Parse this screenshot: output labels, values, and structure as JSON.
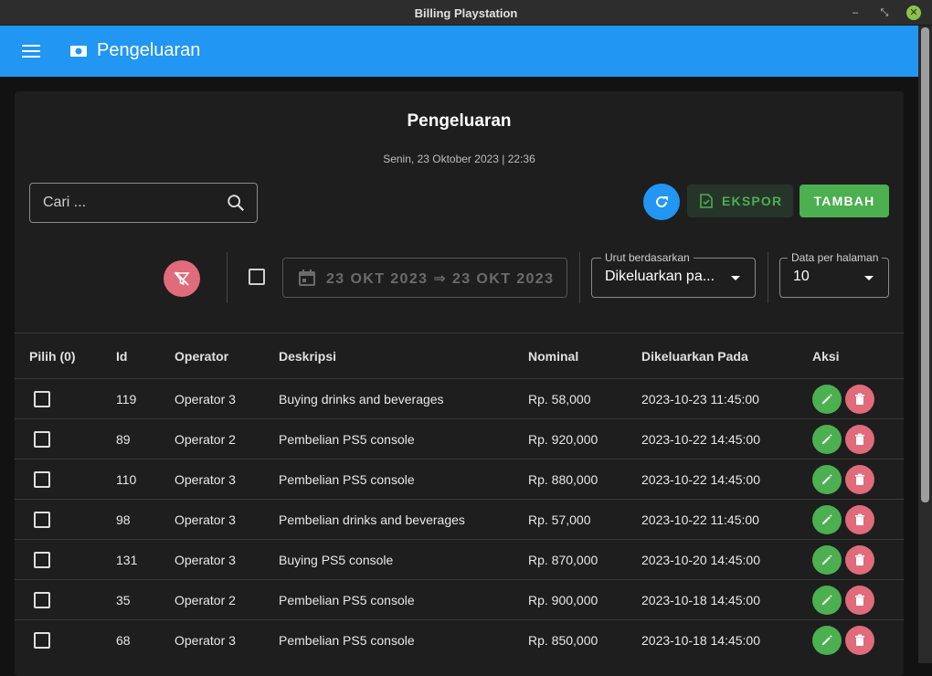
{
  "window": {
    "title": "Billing Playstation"
  },
  "appbar": {
    "title": "Pengeluaran"
  },
  "page": {
    "title": "Pengeluaran",
    "date": "Senin, 23 Oktober 2023 | 22:36"
  },
  "search": {
    "placeholder": "Cari ..."
  },
  "toolbar": {
    "export_label": "EKSPOR",
    "add_label": "TAMBAH"
  },
  "filters": {
    "date_range": "23 OKT 2023 ⇒ 23 OKT 2023",
    "sort": {
      "label": "Urut berdasarkan",
      "value": "Dikeluarkan pa..."
    },
    "per_page": {
      "label": "Data per halaman",
      "value": "10"
    }
  },
  "table": {
    "headers": [
      "Pilih (0)",
      "Id",
      "Operator",
      "Deskripsi",
      "Nominal",
      "Dikeluarkan Pada",
      "Aksi"
    ],
    "rows": [
      {
        "id": "119",
        "operator": "Operator 3",
        "desc": "Buying drinks and beverages",
        "nominal": "Rp. 58,000",
        "date": "2023-10-23 11:45:00"
      },
      {
        "id": "89",
        "operator": "Operator 2",
        "desc": "Pembelian PS5 console",
        "nominal": "Rp. 920,000",
        "date": "2023-10-22 14:45:00"
      },
      {
        "id": "110",
        "operator": "Operator 3",
        "desc": "Pembelian PS5 console",
        "nominal": "Rp. 880,000",
        "date": "2023-10-22 14:45:00"
      },
      {
        "id": "98",
        "operator": "Operator 3",
        "desc": "Pembelian drinks and beverages",
        "nominal": "Rp. 57,000",
        "date": "2023-10-22 11:45:00"
      },
      {
        "id": "131",
        "operator": "Operator 3",
        "desc": "Buying PS5 console",
        "nominal": "Rp. 870,000",
        "date": "2023-10-20 14:45:00"
      },
      {
        "id": "35",
        "operator": "Operator 2",
        "desc": "Pembelian PS5 console",
        "nominal": "Rp. 900,000",
        "date": "2023-10-18 14:45:00"
      },
      {
        "id": "68",
        "operator": "Operator 3",
        "desc": "Pembelian PS5 console",
        "nominal": "Rp. 850,000",
        "date": "2023-10-18 14:45:00"
      }
    ]
  },
  "colors": {
    "primary": "#2196f3",
    "success": "#4caf50",
    "danger": "#e06b7a",
    "background": "#121212",
    "surface": "#1e1e1e"
  },
  "icons": [
    "menu-icon",
    "money-icon",
    "search-icon",
    "refresh-icon",
    "export-file-icon",
    "filter-off-icon",
    "calendar-icon",
    "pencil-icon",
    "trash-icon"
  ]
}
